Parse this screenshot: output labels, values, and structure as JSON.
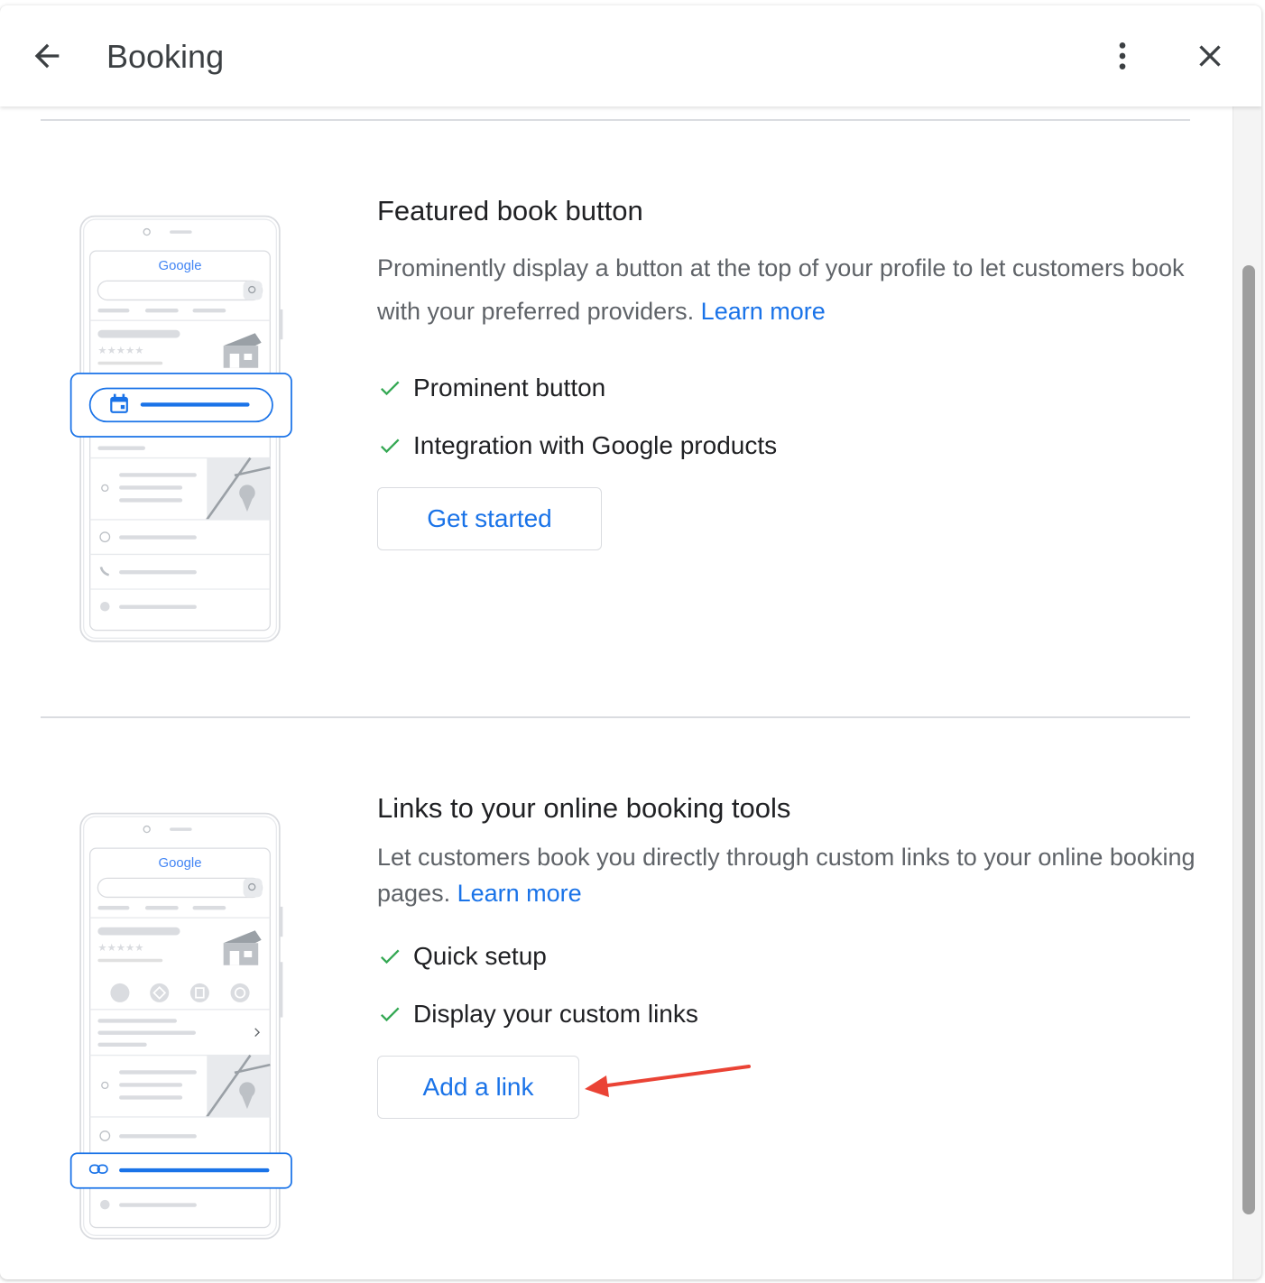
{
  "header": {
    "title": "Booking",
    "icons": {
      "back": "arrow-back-icon",
      "more": "more-vert-icon",
      "close": "close-icon"
    }
  },
  "brand": {
    "logo_text": "Google"
  },
  "sections": [
    {
      "title": "Featured book button",
      "description": "Prominently display a button at the top of your profile to let customers book with your preferred providers.",
      "learn_more": "Learn more",
      "features": [
        "Prominent button",
        "Integration with Google products"
      ],
      "button_label": "Get started"
    },
    {
      "title": "Links to your online booking tools",
      "description": "Let customers book you directly through custom links to your online booking pages.",
      "learn_more": "Learn more",
      "features": [
        "Quick setup",
        "Display your custom links"
      ],
      "button_label": "Add a link"
    }
  ],
  "colors": {
    "accent": "#1a73e8",
    "check": "#34a853",
    "annotation": "#ea4335",
    "text": "#202124",
    "muted": "#5f6368"
  }
}
